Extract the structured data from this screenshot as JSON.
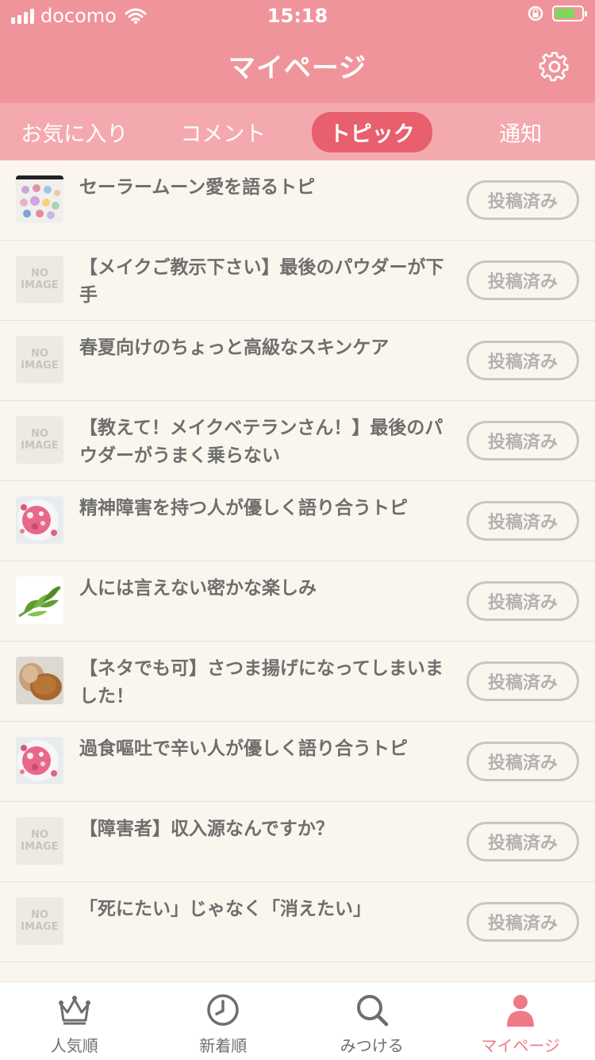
{
  "status_bar": {
    "carrier": "docomo",
    "time": "15:18"
  },
  "header": {
    "title": "マイページ"
  },
  "tabs": [
    {
      "label": "お気に入り",
      "active": false
    },
    {
      "label": "コメント",
      "active": false
    },
    {
      "label": "トピック",
      "active": true
    },
    {
      "label": "通知",
      "active": false
    }
  ],
  "no_image_text": {
    "line1": "NO",
    "line2": "IMAGE"
  },
  "topics": [
    {
      "title": "セーラームーン愛を語るトピ",
      "thumb": "photo",
      "button": "投稿済み"
    },
    {
      "title": "【メイクご教示下さい】最後のパウダーが下手",
      "thumb": "none",
      "button": "投稿済み"
    },
    {
      "title": "春夏向けのちょっと高級なスキンケア",
      "thumb": "none",
      "button": "投稿済み"
    },
    {
      "title": "【教えて！メイクベテランさん！】最後のパウダーがうまく乗らない",
      "thumb": "none",
      "button": "投稿済み"
    },
    {
      "title": "精神障害を持つ人が優しく語り合うトピ",
      "thumb": "photo",
      "button": "投稿済み"
    },
    {
      "title": "人には言えない密かな楽しみ",
      "thumb": "photo",
      "button": "投稿済み"
    },
    {
      "title": "【ネタでも可】さつま揚げになってしまいました！",
      "thumb": "photo",
      "button": "投稿済み"
    },
    {
      "title": "過食嘔吐で辛い人が優しく語り合うトピ",
      "thumb": "photo",
      "button": "投稿済み"
    },
    {
      "title": "【障害者】収入源なんですか？",
      "thumb": "none",
      "button": "投稿済み"
    },
    {
      "title": "「死にたい」じゃなく「消えたい」",
      "thumb": "none",
      "button": "投稿済み"
    }
  ],
  "bottom_nav": [
    {
      "label": "人気順",
      "icon": "crown-icon",
      "active": false
    },
    {
      "label": "新着順",
      "icon": "clock-icon",
      "active": false
    },
    {
      "label": "みつける",
      "icon": "search-icon",
      "active": false
    },
    {
      "label": "マイページ",
      "icon": "person-icon",
      "active": true
    }
  ],
  "colors": {
    "header": "#f0949b",
    "tabs": "#f4a9ae",
    "active_tab": "#e85f6e",
    "active_nav": "#ef7a86",
    "background": "#faf6ee"
  }
}
